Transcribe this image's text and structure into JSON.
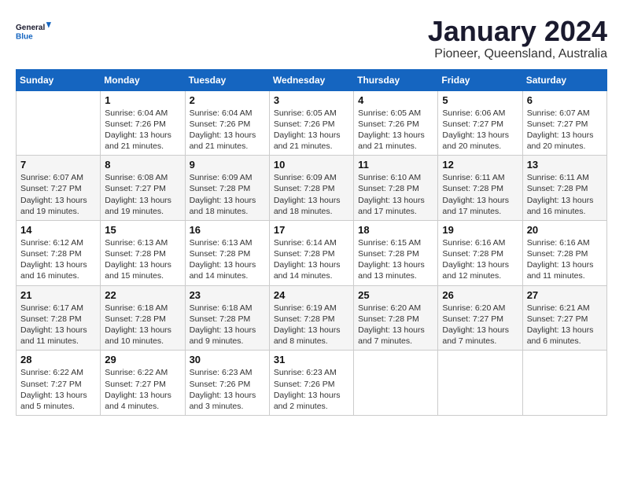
{
  "logo": {
    "line1": "General",
    "line2": "Blue"
  },
  "title": "January 2024",
  "location": "Pioneer, Queensland, Australia",
  "weekdays": [
    "Sunday",
    "Monday",
    "Tuesday",
    "Wednesday",
    "Thursday",
    "Friday",
    "Saturday"
  ],
  "weeks": [
    [
      {
        "day": "",
        "info": ""
      },
      {
        "day": "1",
        "info": "Sunrise: 6:04 AM\nSunset: 7:26 PM\nDaylight: 13 hours\nand 21 minutes."
      },
      {
        "day": "2",
        "info": "Sunrise: 6:04 AM\nSunset: 7:26 PM\nDaylight: 13 hours\nand 21 minutes."
      },
      {
        "day": "3",
        "info": "Sunrise: 6:05 AM\nSunset: 7:26 PM\nDaylight: 13 hours\nand 21 minutes."
      },
      {
        "day": "4",
        "info": "Sunrise: 6:05 AM\nSunset: 7:26 PM\nDaylight: 13 hours\nand 21 minutes."
      },
      {
        "day": "5",
        "info": "Sunrise: 6:06 AM\nSunset: 7:27 PM\nDaylight: 13 hours\nand 20 minutes."
      },
      {
        "day": "6",
        "info": "Sunrise: 6:07 AM\nSunset: 7:27 PM\nDaylight: 13 hours\nand 20 minutes."
      }
    ],
    [
      {
        "day": "7",
        "info": "Sunrise: 6:07 AM\nSunset: 7:27 PM\nDaylight: 13 hours\nand 19 minutes."
      },
      {
        "day": "8",
        "info": "Sunrise: 6:08 AM\nSunset: 7:27 PM\nDaylight: 13 hours\nand 19 minutes."
      },
      {
        "day": "9",
        "info": "Sunrise: 6:09 AM\nSunset: 7:28 PM\nDaylight: 13 hours\nand 18 minutes."
      },
      {
        "day": "10",
        "info": "Sunrise: 6:09 AM\nSunset: 7:28 PM\nDaylight: 13 hours\nand 18 minutes."
      },
      {
        "day": "11",
        "info": "Sunrise: 6:10 AM\nSunset: 7:28 PM\nDaylight: 13 hours\nand 17 minutes."
      },
      {
        "day": "12",
        "info": "Sunrise: 6:11 AM\nSunset: 7:28 PM\nDaylight: 13 hours\nand 17 minutes."
      },
      {
        "day": "13",
        "info": "Sunrise: 6:11 AM\nSunset: 7:28 PM\nDaylight: 13 hours\nand 16 minutes."
      }
    ],
    [
      {
        "day": "14",
        "info": "Sunrise: 6:12 AM\nSunset: 7:28 PM\nDaylight: 13 hours\nand 16 minutes."
      },
      {
        "day": "15",
        "info": "Sunrise: 6:13 AM\nSunset: 7:28 PM\nDaylight: 13 hours\nand 15 minutes."
      },
      {
        "day": "16",
        "info": "Sunrise: 6:13 AM\nSunset: 7:28 PM\nDaylight: 13 hours\nand 14 minutes."
      },
      {
        "day": "17",
        "info": "Sunrise: 6:14 AM\nSunset: 7:28 PM\nDaylight: 13 hours\nand 14 minutes."
      },
      {
        "day": "18",
        "info": "Sunrise: 6:15 AM\nSunset: 7:28 PM\nDaylight: 13 hours\nand 13 minutes."
      },
      {
        "day": "19",
        "info": "Sunrise: 6:16 AM\nSunset: 7:28 PM\nDaylight: 13 hours\nand 12 minutes."
      },
      {
        "day": "20",
        "info": "Sunrise: 6:16 AM\nSunset: 7:28 PM\nDaylight: 13 hours\nand 11 minutes."
      }
    ],
    [
      {
        "day": "21",
        "info": "Sunrise: 6:17 AM\nSunset: 7:28 PM\nDaylight: 13 hours\nand 11 minutes."
      },
      {
        "day": "22",
        "info": "Sunrise: 6:18 AM\nSunset: 7:28 PM\nDaylight: 13 hours\nand 10 minutes."
      },
      {
        "day": "23",
        "info": "Sunrise: 6:18 AM\nSunset: 7:28 PM\nDaylight: 13 hours\nand 9 minutes."
      },
      {
        "day": "24",
        "info": "Sunrise: 6:19 AM\nSunset: 7:28 PM\nDaylight: 13 hours\nand 8 minutes."
      },
      {
        "day": "25",
        "info": "Sunrise: 6:20 AM\nSunset: 7:28 PM\nDaylight: 13 hours\nand 7 minutes."
      },
      {
        "day": "26",
        "info": "Sunrise: 6:20 AM\nSunset: 7:27 PM\nDaylight: 13 hours\nand 7 minutes."
      },
      {
        "day": "27",
        "info": "Sunrise: 6:21 AM\nSunset: 7:27 PM\nDaylight: 13 hours\nand 6 minutes."
      }
    ],
    [
      {
        "day": "28",
        "info": "Sunrise: 6:22 AM\nSunset: 7:27 PM\nDaylight: 13 hours\nand 5 minutes."
      },
      {
        "day": "29",
        "info": "Sunrise: 6:22 AM\nSunset: 7:27 PM\nDaylight: 13 hours\nand 4 minutes."
      },
      {
        "day": "30",
        "info": "Sunrise: 6:23 AM\nSunset: 7:26 PM\nDaylight: 13 hours\nand 3 minutes."
      },
      {
        "day": "31",
        "info": "Sunrise: 6:23 AM\nSunset: 7:26 PM\nDaylight: 13 hours\nand 2 minutes."
      },
      {
        "day": "",
        "info": ""
      },
      {
        "day": "",
        "info": ""
      },
      {
        "day": "",
        "info": ""
      }
    ]
  ]
}
